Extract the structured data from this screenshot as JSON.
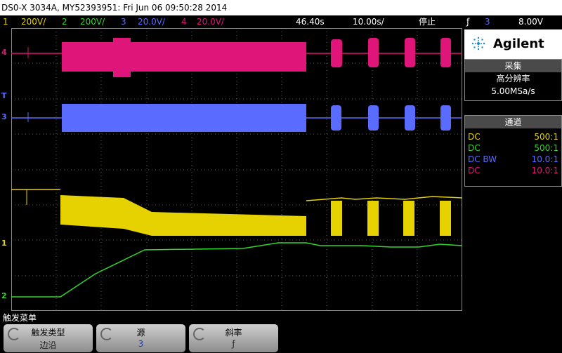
{
  "title": "DS0-X 3034A, MY52393951: Fri Jun 06 09:50:28 2014",
  "status": {
    "ch1": {
      "num": "1",
      "scale": "200V/",
      "color": "#e6d200"
    },
    "ch2": {
      "num": "2",
      "scale": "200V/",
      "color": "#34d62a"
    },
    "ch3": {
      "num": "3",
      "scale": "20.0V/",
      "color": "#5a6cff"
    },
    "ch4": {
      "num": "4",
      "scale": "20.0V/",
      "color": "#e0157a"
    },
    "delay": "46.40s",
    "timebase": "10.00s/",
    "run_state": "停止",
    "trigger_icon": "ƒ",
    "trigger_channel": "3",
    "trigger_level": "8.00V"
  },
  "brand": "Agilent",
  "acquisition": {
    "header": "采集",
    "mode": "高分辨率",
    "rate": "5.00MSa/s"
  },
  "channels_panel": {
    "header": "通道",
    "rows": [
      {
        "coupling": "DC",
        "probe": "500:1",
        "color": "#e6d200"
      },
      {
        "coupling": "DC",
        "probe": "500:1",
        "color": "#34d62a"
      },
      {
        "coupling": "DC BW",
        "probe": "10.0:1",
        "color": "#5a6cff"
      },
      {
        "coupling": "DC",
        "probe": "10.0:1",
        "color": "#e0157a"
      }
    ]
  },
  "markers": {
    "ch4": "4",
    "ch3": "3",
    "ch1": "1",
    "ch2": "2",
    "t": "T"
  },
  "softkeys": {
    "menu_label": "触发菜单",
    "keys": [
      {
        "top": "触发类型",
        "bottom": "边沿"
      },
      {
        "top": "源",
        "bottom": "3"
      },
      {
        "top": "斜率",
        "bottom": "ƒ"
      }
    ]
  },
  "icons": [
    "agilent-logo-icon",
    "trigger-edge-icon",
    "rotate-knob-icon"
  ]
}
